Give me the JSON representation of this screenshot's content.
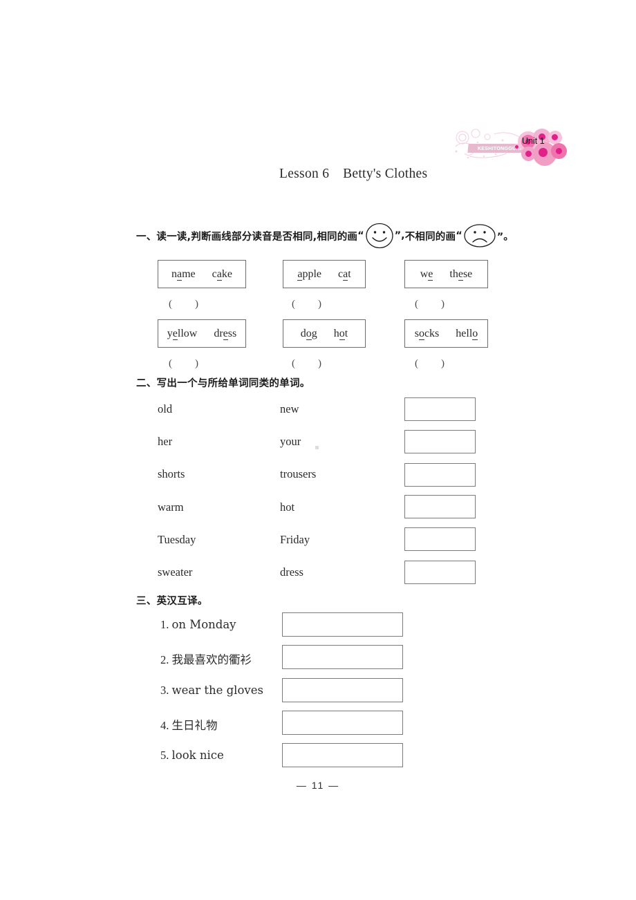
{
  "logo": {
    "band_text": "KESHITONGGUAN",
    "unit_label": "Unit 1",
    "accent_dark": "#e0218a",
    "accent_mid": "#ef73ad",
    "accent_light": "#f7c3dc",
    "band_color": "#e7b9cf"
  },
  "lesson": {
    "title": "Lesson 6　Betty's Clothes"
  },
  "exercise1": {
    "heading_part1": "一、读一读,判断画线部分读音是否相同,相同的画",
    "quote_open": "“",
    "happy_icon": "happy-face-icon",
    "quote_close_comma": "”,",
    "heading_part2": "不相同的画",
    "sad_icon": "sad-face-icon",
    "quote_close_period": "”。",
    "paren_mark": "(　　)",
    "items": [
      {
        "words": [
          {
            "pre": "n",
            "underlined": "a",
            "post": "me"
          },
          {
            "pre": "c",
            "underlined": "a",
            "post": "ke"
          }
        ]
      },
      {
        "words": [
          {
            "pre": "",
            "underlined": "a",
            "post": "pple"
          },
          {
            "pre": "c",
            "underlined": "a",
            "post": "t"
          }
        ]
      },
      {
        "words": [
          {
            "pre": "w",
            "underlined": "e",
            "post": ""
          },
          {
            "pre": "th",
            "underlined": "e",
            "post": "se"
          }
        ]
      },
      {
        "words": [
          {
            "pre": "y",
            "underlined": "e",
            "post": "llow"
          },
          {
            "pre": "dr",
            "underlined": "e",
            "post": "ss"
          }
        ]
      },
      {
        "words": [
          {
            "pre": "d",
            "underlined": "o",
            "post": "g"
          },
          {
            "pre": "h",
            "underlined": "o",
            "post": "t"
          }
        ]
      },
      {
        "words": [
          {
            "pre": "s",
            "underlined": "o",
            "post": "cks"
          },
          {
            "pre": "hell",
            "underlined": "o",
            "post": ""
          }
        ]
      }
    ]
  },
  "exercise2": {
    "heading": "二、写出一个与所给单词同类的单词。",
    "rows": [
      {
        "word1": "old",
        "word2": "new",
        "answer": ""
      },
      {
        "word1": "her",
        "word2": "your",
        "answer": ""
      },
      {
        "word1": "shorts",
        "word2": "trousers",
        "answer": ""
      },
      {
        "word1": "warm",
        "word2": "hot",
        "answer": ""
      },
      {
        "word1": "Tuesday",
        "word2": "Friday",
        "answer": ""
      },
      {
        "word1": "sweater",
        "word2": "dress",
        "answer": ""
      }
    ]
  },
  "exercise3": {
    "heading": "三、英汉互译。",
    "rows": [
      {
        "number": "1.",
        "prompt": "on Monday",
        "answer": ""
      },
      {
        "number": "2.",
        "prompt": "我最喜欢的衢衫",
        "answer": ""
      },
      {
        "number": "3.",
        "prompt": "wear the gloves",
        "answer": ""
      },
      {
        "number": "4.",
        "prompt": "生日礼物",
        "answer": ""
      },
      {
        "number": "5.",
        "prompt": "look nice",
        "answer": ""
      }
    ]
  },
  "footer": {
    "page_number": "—  11  —"
  }
}
